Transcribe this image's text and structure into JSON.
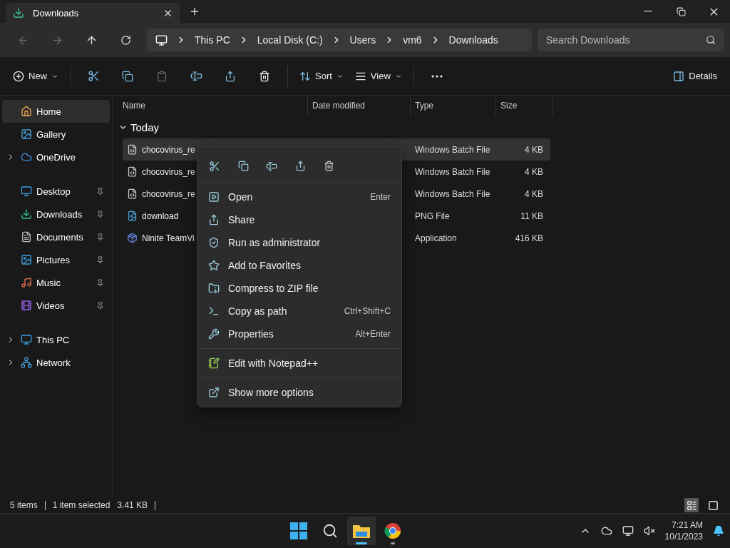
{
  "tab": {
    "title": "Downloads",
    "selected": true
  },
  "breadcrumb": [
    "This PC",
    "Local Disk (C:)",
    "Users",
    "vm6",
    "Downloads"
  ],
  "search": {
    "placeholder": "Search Downloads"
  },
  "commands": {
    "new": "New",
    "sort": "Sort",
    "view": "View",
    "details": "Details"
  },
  "sidebar": {
    "sections": [
      [
        {
          "label": "Home",
          "selected": true,
          "pinned": false
        },
        {
          "label": "Gallery",
          "selected": false,
          "pinned": false
        },
        {
          "label": "OneDrive",
          "selected": false,
          "pinned": false,
          "expanded": false
        }
      ],
      [
        {
          "label": "Desktop",
          "selected": false,
          "pinned": true
        },
        {
          "label": "Downloads",
          "selected": false,
          "pinned": true
        },
        {
          "label": "Documents",
          "selected": false,
          "pinned": true
        },
        {
          "label": "Pictures",
          "selected": false,
          "pinned": true
        },
        {
          "label": "Music",
          "selected": false,
          "pinned": true
        },
        {
          "label": "Videos",
          "selected": false,
          "pinned": true
        }
      ],
      [
        {
          "label": "This PC",
          "selected": false,
          "pinned": false,
          "expanded": false
        },
        {
          "label": "Network",
          "selected": false,
          "pinned": false,
          "expanded": false
        }
      ]
    ]
  },
  "table": {
    "columns": [
      "Name",
      "Date modified",
      "Type",
      "Size"
    ],
    "group": {
      "label": "Today",
      "expanded": true
    },
    "rows": [
      {
        "kind": "batch",
        "name": "chocovirus_re",
        "type": "Windows Batch File",
        "size": "4 KB",
        "selected": true
      },
      {
        "kind": "batch",
        "name": "chocovirus_re",
        "type": "Windows Batch File",
        "size": "4 KB",
        "selected": false
      },
      {
        "kind": "batch",
        "name": "chocovirus_re",
        "type": "Windows Batch File",
        "size": "4 KB",
        "selected": false
      },
      {
        "kind": "image",
        "name": "download",
        "type": "PNG File",
        "size": "11 KB",
        "selected": false
      },
      {
        "kind": "app",
        "name": "Ninite TeamVi",
        "type": "Application",
        "size": "416 KB",
        "selected": false
      }
    ]
  },
  "context_menu": {
    "groups": [
      [
        {
          "label": "Open",
          "shortcut": "Enter"
        },
        {
          "label": "Share"
        },
        {
          "label": "Run as administrator"
        },
        {
          "label": "Add to Favorites"
        },
        {
          "label": "Compress to ZIP file"
        },
        {
          "label": "Copy as path",
          "shortcut": "Ctrl+Shift+C"
        },
        {
          "label": "Properties",
          "shortcut": "Alt+Enter"
        }
      ],
      [
        {
          "label": "Edit with Notepad++"
        }
      ],
      [
        {
          "label": "Show more options"
        }
      ]
    ]
  },
  "status_bar": {
    "count": "5 items",
    "selection": "1 item selected",
    "size": "3.41 KB",
    "views": [
      {
        "selected": true
      },
      {
        "selected": false
      }
    ]
  },
  "taskbar": {
    "apps": [
      {
        "open": false,
        "selected": false
      },
      {
        "open": false,
        "selected": false
      },
      {
        "open": true,
        "selected": true
      },
      {
        "open": true,
        "selected": false
      }
    ],
    "time": "7:21 AM",
    "date": "10/1/2023"
  }
}
